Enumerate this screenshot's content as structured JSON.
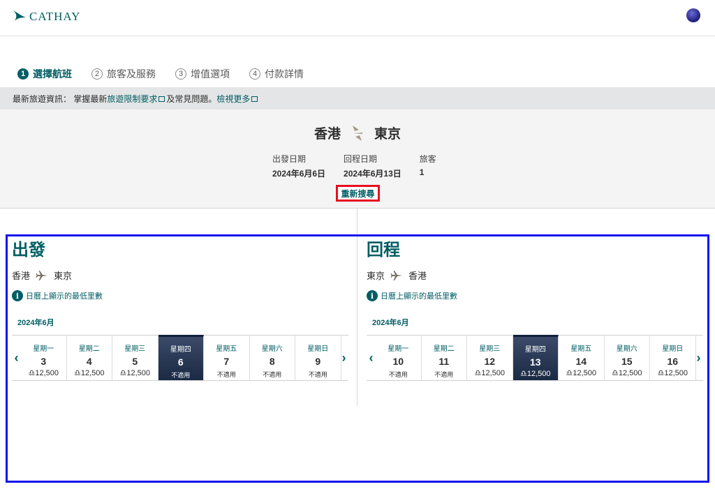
{
  "header": {
    "logo_text": "CATHAY"
  },
  "steps": [
    {
      "num": "1",
      "label": "選擇航班",
      "active": true
    },
    {
      "num": "2",
      "label": "旅客及服務",
      "active": false
    },
    {
      "num": "3",
      "label": "增值選項",
      "active": false
    },
    {
      "num": "4",
      "label": "付款詳情",
      "active": false
    }
  ],
  "info_bar": {
    "prefix": "最新旅遊資訊：  掌握最新",
    "link1": "旅遊限制要求",
    "middle": "及常見問題。",
    "link2": "檢視更多"
  },
  "summary": {
    "origin": "香港",
    "destination": "東京",
    "depart_label": "出發日期",
    "depart_value": "2024年6月6日",
    "return_label": "回程日期",
    "return_value": "2024年6月13日",
    "pax_label": "旅客",
    "pax_value": "1",
    "modify_label": "重新搜尋"
  },
  "outbound": {
    "title": "出發",
    "from": "香港",
    "to": "東京",
    "note": "日曆上顯示的最低里數",
    "month": "2024年6月",
    "days": [
      {
        "name": "星期一",
        "num": "3",
        "price": "♎12,500",
        "na": false,
        "selected": false
      },
      {
        "name": "星期二",
        "num": "4",
        "price": "♎12,500",
        "na": false,
        "selected": false
      },
      {
        "name": "星期三",
        "num": "5",
        "price": "♎12,500",
        "na": false,
        "selected": false
      },
      {
        "name": "星期四",
        "num": "6",
        "price": "不適用",
        "na": true,
        "selected": true
      },
      {
        "name": "星期五",
        "num": "7",
        "price": "不適用",
        "na": true,
        "selected": false
      },
      {
        "name": "星期六",
        "num": "8",
        "price": "不適用",
        "na": true,
        "selected": false
      },
      {
        "name": "星期日",
        "num": "9",
        "price": "不適用",
        "na": true,
        "selected": false
      }
    ]
  },
  "inbound": {
    "title": "回程",
    "from": "東京",
    "to": "香港",
    "note": "日曆上顯示的最低里數",
    "month": "2024年6月",
    "days": [
      {
        "name": "星期一",
        "num": "10",
        "price": "不適用",
        "na": true,
        "selected": false
      },
      {
        "name": "星期二",
        "num": "11",
        "price": "不適用",
        "na": true,
        "selected": false
      },
      {
        "name": "星期三",
        "num": "12",
        "price": "♎12,500",
        "na": false,
        "selected": false
      },
      {
        "name": "星期四",
        "num": "13",
        "price": "♎12,500",
        "na": false,
        "selected": true
      },
      {
        "name": "星期五",
        "num": "14",
        "price": "♎12,500",
        "na": false,
        "selected": false
      },
      {
        "name": "星期六",
        "num": "15",
        "price": "♎12,500",
        "na": false,
        "selected": false
      },
      {
        "name": "星期日",
        "num": "16",
        "price": "♎12,500",
        "na": false,
        "selected": false
      }
    ]
  },
  "colors": {
    "brand": "#005d63",
    "selected_day": "#1a2a44",
    "highlight_red": "#e8101e",
    "highlight_blue": "#1010ee"
  }
}
